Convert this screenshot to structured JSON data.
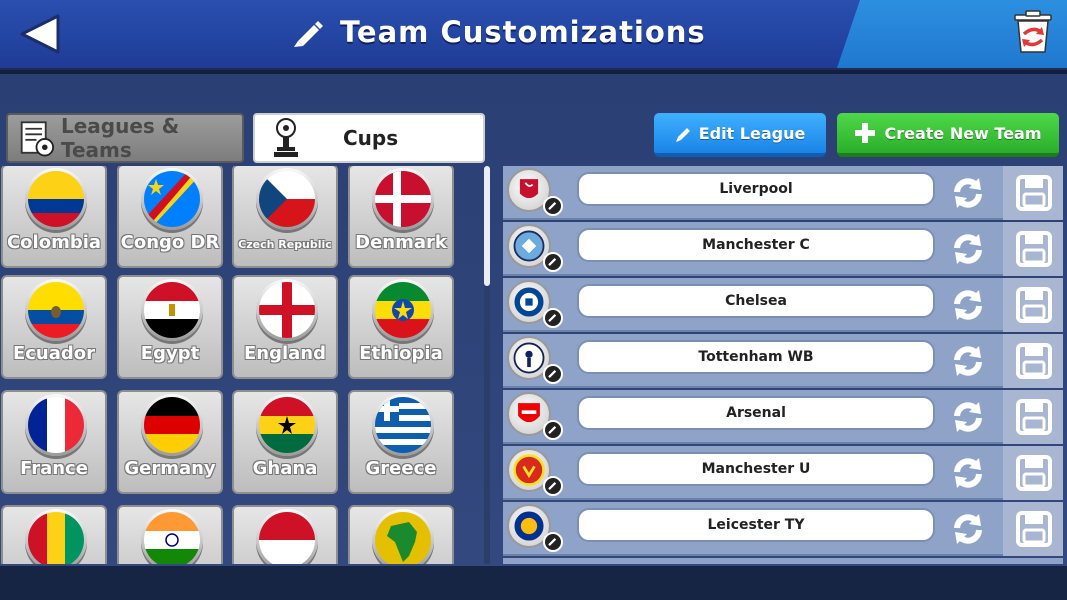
{
  "header": {
    "title": "Team Customizations",
    "back_icon": "back-arrow-icon",
    "edit_icon": "pencil-icon",
    "trash_icon": "trash-reset-icon"
  },
  "tabs": [
    {
      "label": "Leagues & Teams",
      "icon": "leagues-teams-icon",
      "active": false
    },
    {
      "label": "Cups",
      "icon": "trophy-icon",
      "active": true
    }
  ],
  "actions": {
    "edit_league": "Edit League",
    "create_team": "Create New Team"
  },
  "countries": [
    {
      "name": "Colombia"
    },
    {
      "name": "Congo DR"
    },
    {
      "name": "Czech Republic"
    },
    {
      "name": "Denmark"
    },
    {
      "name": "Ecuador"
    },
    {
      "name": "Egypt"
    },
    {
      "name": "England"
    },
    {
      "name": "Ethiopia"
    },
    {
      "name": "France"
    },
    {
      "name": "Germany"
    },
    {
      "name": "Ghana"
    },
    {
      "name": "Greece"
    },
    {
      "name": ""
    },
    {
      "name": ""
    },
    {
      "name": ""
    },
    {
      "name": ""
    }
  ],
  "teams": [
    {
      "name": "Liverpool",
      "color": "#c8102e"
    },
    {
      "name": "Manchester C",
      "color": "#6cabdd"
    },
    {
      "name": "Chelsea",
      "color": "#034694"
    },
    {
      "name": "Tottenham WB",
      "color": "#132257"
    },
    {
      "name": "Arsenal",
      "color": "#ef0107"
    },
    {
      "name": "Manchester U",
      "color": "#da291c"
    },
    {
      "name": "Leicester TY",
      "color": "#003090"
    }
  ],
  "colors": {
    "header": "#1e3c96",
    "edit_button": "#1a84e6",
    "create_button": "#2bae2a",
    "row_bg": "#8fa3c8"
  }
}
